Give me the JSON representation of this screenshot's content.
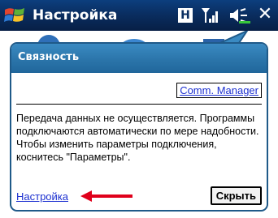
{
  "titlebar": {
    "title": "Настройка",
    "status_h": "H",
    "close_glyph": "✕"
  },
  "balloon": {
    "title": "Связность",
    "comm_manager_link": "Comm. Manager",
    "message": "Передача данных не осуществляется. Программы подключаются автоматически по мере надобности. Чтобы изменить параметры подключения, коснитесь \"Параметры\".",
    "settings_link": "Настройка",
    "hide_button": "Скрыть"
  },
  "colors": {
    "titlebar": "#0a2e61",
    "balloon_header": "#2b75aa",
    "link": "#1b2fd0",
    "arrow": "#e0001b"
  },
  "icons": {
    "start": "windows-flag-icon",
    "signal": "signal-strength-icon",
    "volume": "volume-icon",
    "close": "close-icon"
  }
}
